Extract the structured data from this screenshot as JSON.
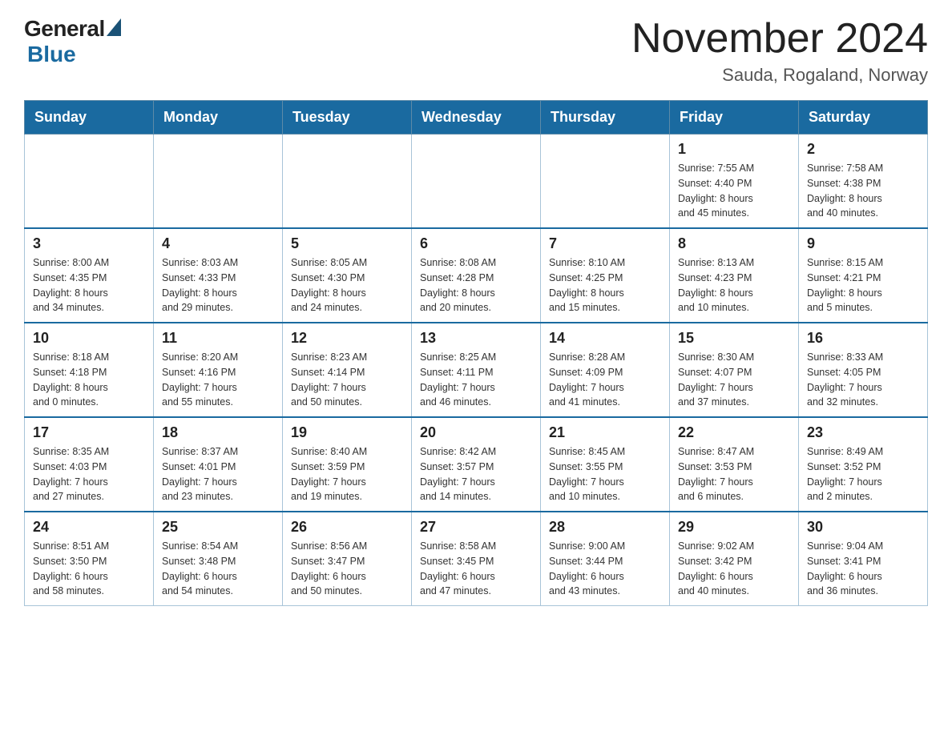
{
  "header": {
    "logo_general": "General",
    "logo_blue": "Blue",
    "month_title": "November 2024",
    "location": "Sauda, Rogaland, Norway"
  },
  "weekdays": [
    "Sunday",
    "Monday",
    "Tuesday",
    "Wednesday",
    "Thursday",
    "Friday",
    "Saturday"
  ],
  "weeks": [
    [
      {
        "day": "",
        "info": ""
      },
      {
        "day": "",
        "info": ""
      },
      {
        "day": "",
        "info": ""
      },
      {
        "day": "",
        "info": ""
      },
      {
        "day": "",
        "info": ""
      },
      {
        "day": "1",
        "info": "Sunrise: 7:55 AM\nSunset: 4:40 PM\nDaylight: 8 hours\nand 45 minutes."
      },
      {
        "day": "2",
        "info": "Sunrise: 7:58 AM\nSunset: 4:38 PM\nDaylight: 8 hours\nand 40 minutes."
      }
    ],
    [
      {
        "day": "3",
        "info": "Sunrise: 8:00 AM\nSunset: 4:35 PM\nDaylight: 8 hours\nand 34 minutes."
      },
      {
        "day": "4",
        "info": "Sunrise: 8:03 AM\nSunset: 4:33 PM\nDaylight: 8 hours\nand 29 minutes."
      },
      {
        "day": "5",
        "info": "Sunrise: 8:05 AM\nSunset: 4:30 PM\nDaylight: 8 hours\nand 24 minutes."
      },
      {
        "day": "6",
        "info": "Sunrise: 8:08 AM\nSunset: 4:28 PM\nDaylight: 8 hours\nand 20 minutes."
      },
      {
        "day": "7",
        "info": "Sunrise: 8:10 AM\nSunset: 4:25 PM\nDaylight: 8 hours\nand 15 minutes."
      },
      {
        "day": "8",
        "info": "Sunrise: 8:13 AM\nSunset: 4:23 PM\nDaylight: 8 hours\nand 10 minutes."
      },
      {
        "day": "9",
        "info": "Sunrise: 8:15 AM\nSunset: 4:21 PM\nDaylight: 8 hours\nand 5 minutes."
      }
    ],
    [
      {
        "day": "10",
        "info": "Sunrise: 8:18 AM\nSunset: 4:18 PM\nDaylight: 8 hours\nand 0 minutes."
      },
      {
        "day": "11",
        "info": "Sunrise: 8:20 AM\nSunset: 4:16 PM\nDaylight: 7 hours\nand 55 minutes."
      },
      {
        "day": "12",
        "info": "Sunrise: 8:23 AM\nSunset: 4:14 PM\nDaylight: 7 hours\nand 50 minutes."
      },
      {
        "day": "13",
        "info": "Sunrise: 8:25 AM\nSunset: 4:11 PM\nDaylight: 7 hours\nand 46 minutes."
      },
      {
        "day": "14",
        "info": "Sunrise: 8:28 AM\nSunset: 4:09 PM\nDaylight: 7 hours\nand 41 minutes."
      },
      {
        "day": "15",
        "info": "Sunrise: 8:30 AM\nSunset: 4:07 PM\nDaylight: 7 hours\nand 37 minutes."
      },
      {
        "day": "16",
        "info": "Sunrise: 8:33 AM\nSunset: 4:05 PM\nDaylight: 7 hours\nand 32 minutes."
      }
    ],
    [
      {
        "day": "17",
        "info": "Sunrise: 8:35 AM\nSunset: 4:03 PM\nDaylight: 7 hours\nand 27 minutes."
      },
      {
        "day": "18",
        "info": "Sunrise: 8:37 AM\nSunset: 4:01 PM\nDaylight: 7 hours\nand 23 minutes."
      },
      {
        "day": "19",
        "info": "Sunrise: 8:40 AM\nSunset: 3:59 PM\nDaylight: 7 hours\nand 19 minutes."
      },
      {
        "day": "20",
        "info": "Sunrise: 8:42 AM\nSunset: 3:57 PM\nDaylight: 7 hours\nand 14 minutes."
      },
      {
        "day": "21",
        "info": "Sunrise: 8:45 AM\nSunset: 3:55 PM\nDaylight: 7 hours\nand 10 minutes."
      },
      {
        "day": "22",
        "info": "Sunrise: 8:47 AM\nSunset: 3:53 PM\nDaylight: 7 hours\nand 6 minutes."
      },
      {
        "day": "23",
        "info": "Sunrise: 8:49 AM\nSunset: 3:52 PM\nDaylight: 7 hours\nand 2 minutes."
      }
    ],
    [
      {
        "day": "24",
        "info": "Sunrise: 8:51 AM\nSunset: 3:50 PM\nDaylight: 6 hours\nand 58 minutes."
      },
      {
        "day": "25",
        "info": "Sunrise: 8:54 AM\nSunset: 3:48 PM\nDaylight: 6 hours\nand 54 minutes."
      },
      {
        "day": "26",
        "info": "Sunrise: 8:56 AM\nSunset: 3:47 PM\nDaylight: 6 hours\nand 50 minutes."
      },
      {
        "day": "27",
        "info": "Sunrise: 8:58 AM\nSunset: 3:45 PM\nDaylight: 6 hours\nand 47 minutes."
      },
      {
        "day": "28",
        "info": "Sunrise: 9:00 AM\nSunset: 3:44 PM\nDaylight: 6 hours\nand 43 minutes."
      },
      {
        "day": "29",
        "info": "Sunrise: 9:02 AM\nSunset: 3:42 PM\nDaylight: 6 hours\nand 40 minutes."
      },
      {
        "day": "30",
        "info": "Sunrise: 9:04 AM\nSunset: 3:41 PM\nDaylight: 6 hours\nand 36 minutes."
      }
    ]
  ]
}
